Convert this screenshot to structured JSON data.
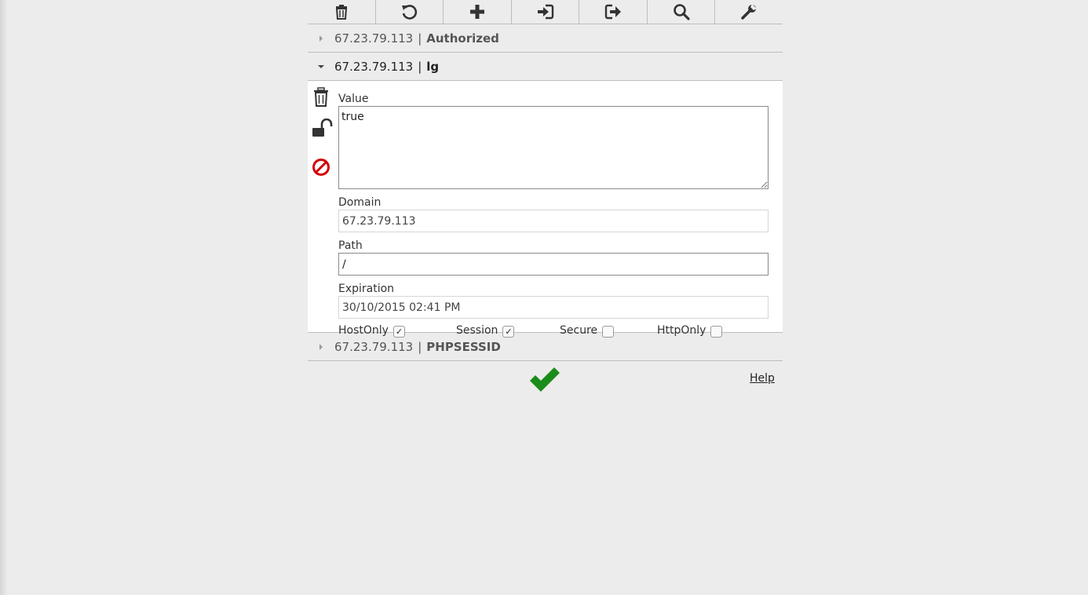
{
  "toolbar": {
    "icons": [
      "trash-icon",
      "undo-icon",
      "plus-icon",
      "import-icon",
      "export-icon",
      "search-icon",
      "wrench-icon"
    ]
  },
  "cookies": [
    {
      "domain": "67.23.79.113",
      "separator": "|",
      "name": "Authorized",
      "expanded": false
    },
    {
      "domain": "67.23.79.113",
      "separator": "|",
      "name": "lg",
      "expanded": true
    },
    {
      "domain": "67.23.79.113",
      "separator": "|",
      "name": "PHPSESSID",
      "expanded": false
    }
  ],
  "editor": {
    "value_label": "Value",
    "value": "true",
    "domain_label": "Domain",
    "domain": "67.23.79.113",
    "path_label": "Path",
    "path": "/",
    "expiration_label": "Expiration",
    "expiration": "30/10/2015 02:41 PM",
    "flags": [
      {
        "label": "HostOnly",
        "checked": true
      },
      {
        "label": "Session",
        "checked": true
      },
      {
        "label": "Secure",
        "checked": false
      },
      {
        "label": "HttpOnly",
        "checked": false
      }
    ],
    "check_mark": "✓"
  },
  "footer": {
    "help_label": "Help"
  },
  "colors": {
    "accept": "#1a8c1a",
    "block": "#d40000",
    "icon": "#333333"
  }
}
